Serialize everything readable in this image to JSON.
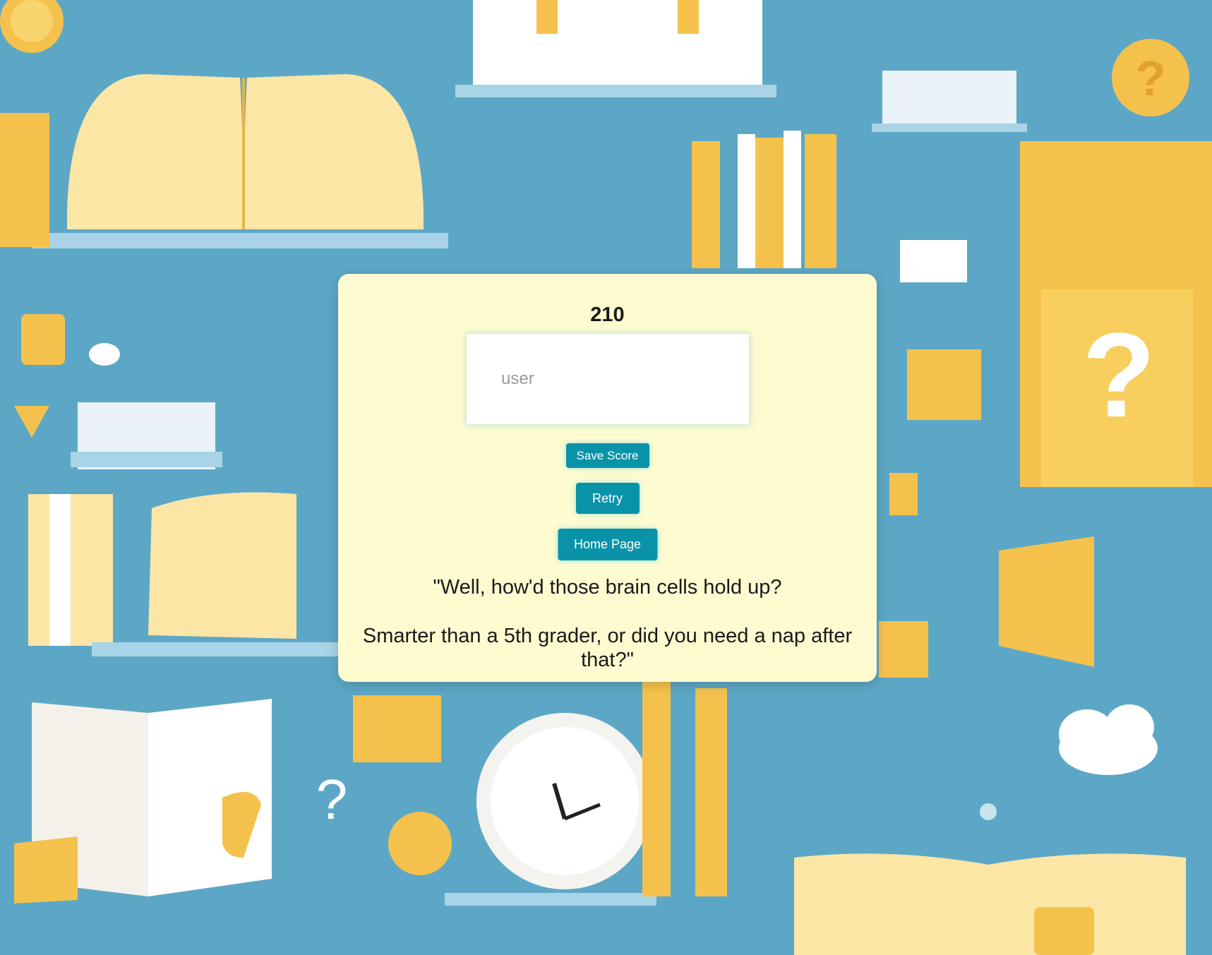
{
  "result": {
    "score": "210",
    "username_input": {
      "value": "",
      "placeholder": "user"
    },
    "buttons": {
      "save_score": "Save Score",
      "retry": "Retry",
      "home_page": "Home Page"
    },
    "quote_line_1": "\"Well, how'd those brain cells hold up?",
    "quote_line_2": "Smarter than a 5th grader, or did you need a nap after that?\""
  },
  "theme": {
    "background": "#5da7c6",
    "card_background": "#fefbd0",
    "button_color": "#0a93a8",
    "illustration_yellow": "#f4c24c",
    "illustration_cream": "#fbe6a6",
    "illustration_light_blue": "#a9d3e6"
  }
}
